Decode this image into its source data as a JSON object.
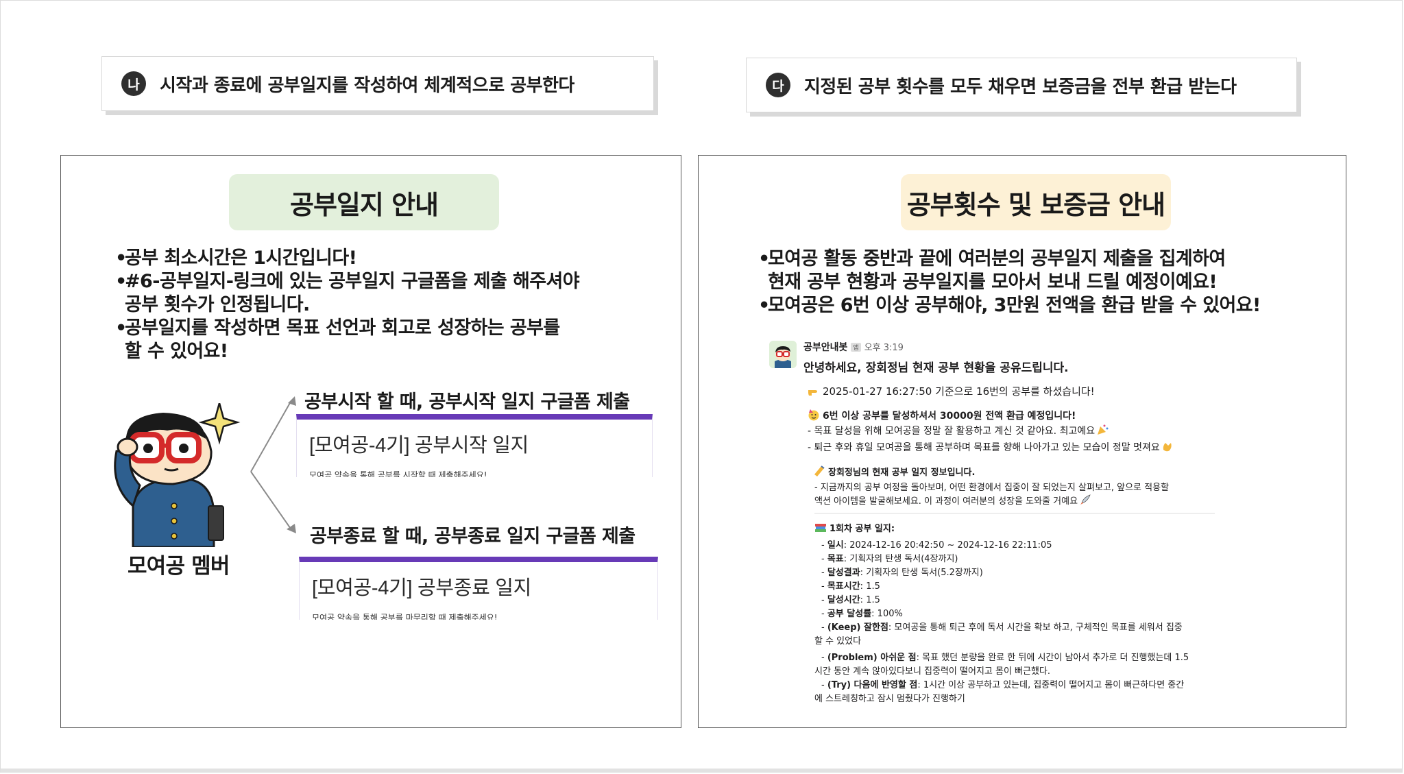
{
  "banners": {
    "left": {
      "badge": "나",
      "text": "시작과 종료에 공부일지를 작성하여 체계적으로 공부한다"
    },
    "right": {
      "badge": "다",
      "text": "지정된 공부 횟수를 모두 채우면 보증금을 전부 환급 받는다"
    }
  },
  "left_panel": {
    "title": "공부일지 안내",
    "title_color": "#e3f0dc",
    "bullets": [
      {
        "lines": [
          "공부 최소시간은 1시간입니다!"
        ]
      },
      {
        "lines": [
          "#6-공부일지-링크에 있는 공부일지 구글폼을 제출 해주셔야",
          "공부 횟수가 인정됩니다."
        ]
      },
      {
        "lines": [
          "공부일지를 작성하면 목표 선언과 회고로 성장하는 공부를",
          "할 수 있어요!"
        ]
      }
    ],
    "start_caption": "공부시작 할 때, 공부시작 일지 구글폼 제출",
    "start_form": {
      "title": "[모여공-4기] 공부시작 일지",
      "desc": "모여공 약속을 통해 공부를 시작할 때 제출해주세요!"
    },
    "end_caption": "공부종료 할 때, 공부종료 일지 구글폼 제출",
    "end_form": {
      "title": "[모여공-4기] 공부종료 일지",
      "desc": "모여공 약속을 통해 공부를 마무리할 때 제출해주세요!"
    },
    "member_label": "모여공 멤버",
    "form_accent": "#673ab7"
  },
  "right_panel": {
    "title": "공부횟수 및 보증금 안내",
    "title_color": "#fdf1d6",
    "bullets": [
      {
        "lines": [
          "모여공 활동 중반과 끝에 여러분의 공부일지 제출을 집계하여",
          "현재 공부 현황과 공부일지를 모아서 보내 드릴 예정이예요!"
        ]
      },
      {
        "lines": [
          "모여공은 6번 이상 공부해야, 3만원 전액을 환급 받을 수 있어요!"
        ]
      }
    ],
    "message": {
      "sender": "공부안내봇",
      "app_tag": "앱",
      "time": "오후 3:19",
      "greeting": "안녕하세요, 장회정님 현재 공부 현황을 공유드립니다.",
      "count_line": "2025-01-27 16:27:50 기준으로 16번의 공부를 하셨습니다!",
      "refund_line": "6번 이상 공부를 달성하셔서 30000원 전액 환급 예정입니다!",
      "praise_1": "- 목표 달성을 위해 모여공을 정말 잘 활용하고 계신 것 같아요. 최고예요",
      "praise_2": "- 퇴근 후와 휴일 모여공을 통해 공부하며 목표를 향해 나아가고 있는 모습이 정말 멋져요",
      "info_title": "장회정님의 현재 공부 일지 정보입니다.",
      "info_1": "- 지금까지의 공부 여정을 돌아보며, 어떤 환경에서 집중이 잘 되었는지 살펴보고, 앞으로 적용할",
      "info_2": "액션 아이템을 발굴해보세요. 이 과정이 여러분의 성장을 도와줄 거예요",
      "log_title": "1회차 공부 일지:",
      "log": {
        "date_label": "일시",
        "date": "2024-12-16 20:42:50 ~ 2024-12-16 22:11:05",
        "goal_label": "목표",
        "goal": "기획자의 탄생 독서(4장까지)",
        "result_label": "달성결과",
        "result": "기획자의 탄생 독서(5.2장까지)",
        "goal_time_label": "목표시간",
        "goal_time": "1.5",
        "done_time_label": "달성시간",
        "done_time": "1.5",
        "rate_label": "공부 달성률",
        "rate": "100%",
        "keep_label": "(Keep) 잘한점",
        "keep_1": "모여공을 통해 퇴근 후에 독서 시간을 확보 하고, 구체적인 목표를 세워서 집중",
        "keep_2": "할 수 있었다",
        "problem_label": "(Problem)  아쉬운 점",
        "problem_1": "목표 했던 분량을 완료 한 뒤에 시간이 남아서 추가로 더 진행했는데 1.5",
        "problem_2": "시간 동안 계속 앉아있다보니 집중력이 떨어지고 몸이 뻐근했다.",
        "try_label": "(Try)  다음에 반영할 점",
        "try_1": "1시간 이상 공부하고 있는데, 집중력이 떨어지고 몸이 뻐근하다면 중간",
        "try_2": "에 스트레칭하고 잠시 멈췄다가 진행하기"
      }
    }
  }
}
